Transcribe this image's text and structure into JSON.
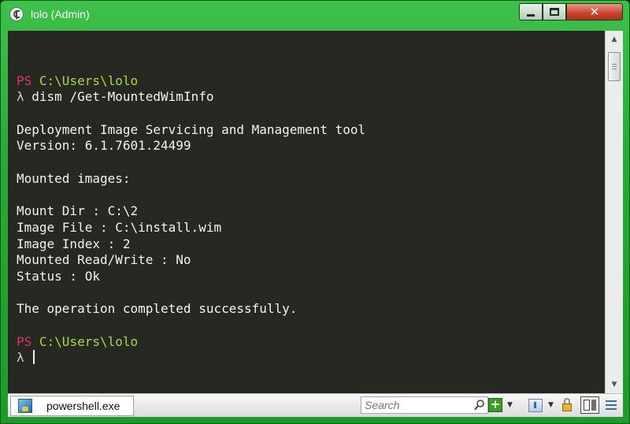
{
  "window": {
    "title": "lolo (Admin)",
    "icon": "conemu-icon",
    "controls": {
      "minimize": "minimize-icon",
      "maximize": "maximize-icon",
      "close_glyph": "✕"
    }
  },
  "console": {
    "lines": [
      {
        "type": "blank"
      },
      {
        "type": "prompt",
        "ps": "PS",
        "path": "C:\\Users\\lolo"
      },
      {
        "type": "command",
        "lambda": "λ",
        "text": "dism /Get-MountedWimInfo"
      },
      {
        "type": "blank"
      },
      {
        "type": "output",
        "text": "Deployment Image Servicing and Management tool"
      },
      {
        "type": "output",
        "text": "Version: 6.1.7601.24499"
      },
      {
        "type": "blank"
      },
      {
        "type": "output",
        "text": "Mounted images:"
      },
      {
        "type": "blank"
      },
      {
        "type": "output",
        "text": "Mount Dir : C:\\2"
      },
      {
        "type": "output",
        "text": "Image File : C:\\install.wim"
      },
      {
        "type": "output",
        "text": "Image Index : 2"
      },
      {
        "type": "output",
        "text": "Mounted Read/Write : No"
      },
      {
        "type": "output",
        "text": "Status : Ok"
      },
      {
        "type": "blank"
      },
      {
        "type": "output",
        "text": "The operation completed successfully."
      },
      {
        "type": "blank"
      },
      {
        "type": "prompt",
        "ps": "PS",
        "path": "C:\\Users\\lolo"
      },
      {
        "type": "command",
        "lambda": "λ",
        "text": "",
        "cursor": true
      }
    ],
    "colors": {
      "background": "#272822",
      "text": "#f2f2f2",
      "ps": "#e03070",
      "path": "#a8d84a"
    }
  },
  "statusbar": {
    "tab_label": "powershell.exe",
    "tab_icon": "powershell-icon",
    "search_placeholder": "Search",
    "buttons": [
      "new-console-icon",
      "dropdown-icon",
      "tabs-icon",
      "dropdown-icon",
      "lock-icon",
      "split-panel-icon",
      "menu-icon"
    ]
  }
}
